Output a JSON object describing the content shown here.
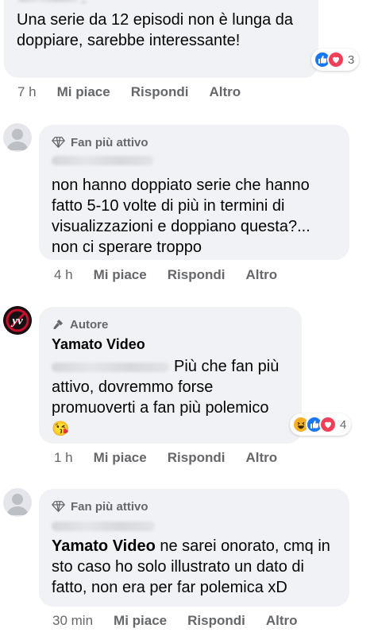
{
  "comments": [
    {
      "text": "Una serie da 12 episodi non è lunga da doppiare, sarebbe interessante!",
      "line1": "Una serie da 12 episodi non è lunga da",
      "line2": "doppiare, sarebbe interessante!",
      "reaction_count": "3",
      "time": "7 h",
      "like_label": "Mi piace",
      "reply_label": "Rispondi",
      "more_label": "Altro"
    },
    {
      "badge": "Fan più attivo",
      "line1": "non hanno doppiato serie che hanno",
      "line2": "fatto 5-10 volte di più in termini di",
      "line3": "visualizzazioni e doppiano questa?...",
      "line4": "non ci sperare troppo",
      "time": "4 h",
      "like_label": "Mi piace",
      "reply_label": "Rispondi",
      "more_label": "Altro"
    },
    {
      "badge": "Autore",
      "author": "Yamato Video",
      "line1": "Più che fan più",
      "line2": "attivo, dovremmo forse",
      "line3": "promuoverti a fan più polemico",
      "emoji": "😘",
      "reaction_count": "4",
      "time": "1 h",
      "like_label": "Mi piace",
      "reply_label": "Rispondi",
      "more_label": "Altro"
    },
    {
      "badge": "Fan più attivo",
      "mention": "Yamato Video",
      "line1_rest": " ne sarei onorato, cmq in",
      "line2": "sto caso ho solo illustrato un dato di",
      "line3": "fatto, non era per far polemica xD",
      "time": "30 min",
      "like_label": "Mi piace",
      "reply_label": "Rispondi",
      "more_label": "Altro"
    }
  ],
  "colors": {
    "bubble": "#f0f2f5",
    "meta_text": "#65676b",
    "like_blue": "#1877f2",
    "love_red": "#f33e58",
    "haha_yellow": "#f7b125"
  }
}
